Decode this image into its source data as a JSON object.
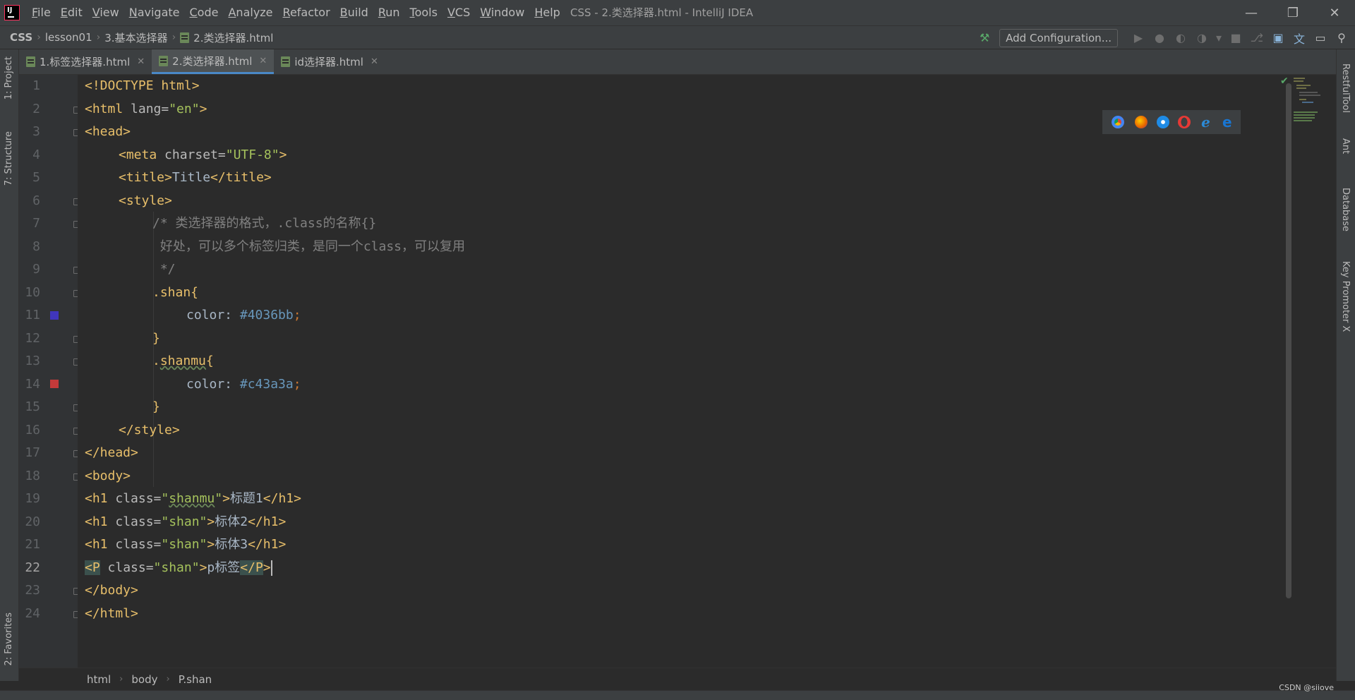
{
  "window": {
    "title": "CSS - 2.类选择器.html - IntelliJ IDEA",
    "menu": [
      "File",
      "Edit",
      "View",
      "Navigate",
      "Code",
      "Analyze",
      "Refactor",
      "Build",
      "Run",
      "Tools",
      "VCS",
      "Window",
      "Help"
    ]
  },
  "breadcrumb": {
    "items": [
      "CSS",
      "lesson01",
      "3.基本选择器",
      "2.类选择器.html"
    ]
  },
  "toolbar": {
    "add_config_label": "Add Configuration..."
  },
  "tool_windows": {
    "left": [
      "1: Project",
      "7: Structure",
      "2: Favorites"
    ],
    "right": [
      "RestfulTool",
      "Ant",
      "Database",
      "Key Promoter X"
    ]
  },
  "tabs": [
    {
      "label": "1.标签选择器.html",
      "active": false
    },
    {
      "label": "2.类选择器.html",
      "active": true
    },
    {
      "label": "id选择器.html",
      "active": false
    }
  ],
  "editor": {
    "current_line": 22,
    "line_numbers": [
      "1",
      "2",
      "3",
      "4",
      "5",
      "6",
      "7",
      "8",
      "9",
      "10",
      "11",
      "12",
      "13",
      "14",
      "15",
      "16",
      "17",
      "18",
      "19",
      "20",
      "21",
      "22",
      "23",
      "24"
    ],
    "color_swatches": {
      "line11": "#4036bb",
      "line14": "#c43a3a"
    },
    "code": {
      "l1": {
        "a": "<!DOCTYPE html>"
      },
      "l2": {
        "a": "<html",
        "b": " lang=",
        "c": "\"en\"",
        "d": ">"
      },
      "l3": {
        "a": "<head>"
      },
      "l4": {
        "a": "<meta",
        "b": " charset=",
        "c": "\"UTF-8\"",
        "d": ">"
      },
      "l5": {
        "a": "<title>",
        "b": "Title",
        "c": "</title>"
      },
      "l6": {
        "a": "<style>"
      },
      "l7": {
        "a": "/* 类选择器的格式，.class的名称{}"
      },
      "l8": {
        "a": " 好处，可以多个标签归类，是同一个class，可以复用"
      },
      "l9": {
        "a": " */"
      },
      "l10": {
        "a": ".shan{"
      },
      "l11": {
        "a": "color: ",
        "b": "#4036bb",
        ";": ";"
      },
      "l12": {
        "a": "}"
      },
      "l13": {
        "a": ".",
        "b": "shanmu",
        "c": "{"
      },
      "l14": {
        "a": "color: ",
        "b": "#c43a3a",
        ";": ";"
      },
      "l15": {
        "a": "}"
      },
      "l16": {
        "a": "</style>"
      },
      "l17": {
        "a": "</head>"
      },
      "l18": {
        "a": "<body>"
      },
      "l19": {
        "a": "<h1",
        "b": " class=",
        "c": "\"",
        "d": "shanmu",
        "e": "\"",
        "f": ">",
        "g": "标题1",
        "h": "</h1>"
      },
      "l20": {
        "a": "<h1",
        "b": " class=",
        "c": "\"shan\"",
        "d": ">",
        "e": "标体2",
        "f": "</h1>"
      },
      "l21": {
        "a": "<h1",
        "b": " class=",
        "c": "\"shan\"",
        "d": ">",
        "e": "标体3",
        "f": "</h1>"
      },
      "l22": {
        "a": "<P",
        "b": " class=",
        "c": "\"shan\"",
        "d": ">",
        "e": "p标签",
        "f": "</P",
        "g": ">"
      },
      "l23": {
        "a": "</body>"
      },
      "l24": {
        "a": "</html>"
      }
    }
  },
  "bottom_breadcrumb": [
    "html",
    "body",
    "P.shan"
  ],
  "watermark": "CSDN @siiove"
}
